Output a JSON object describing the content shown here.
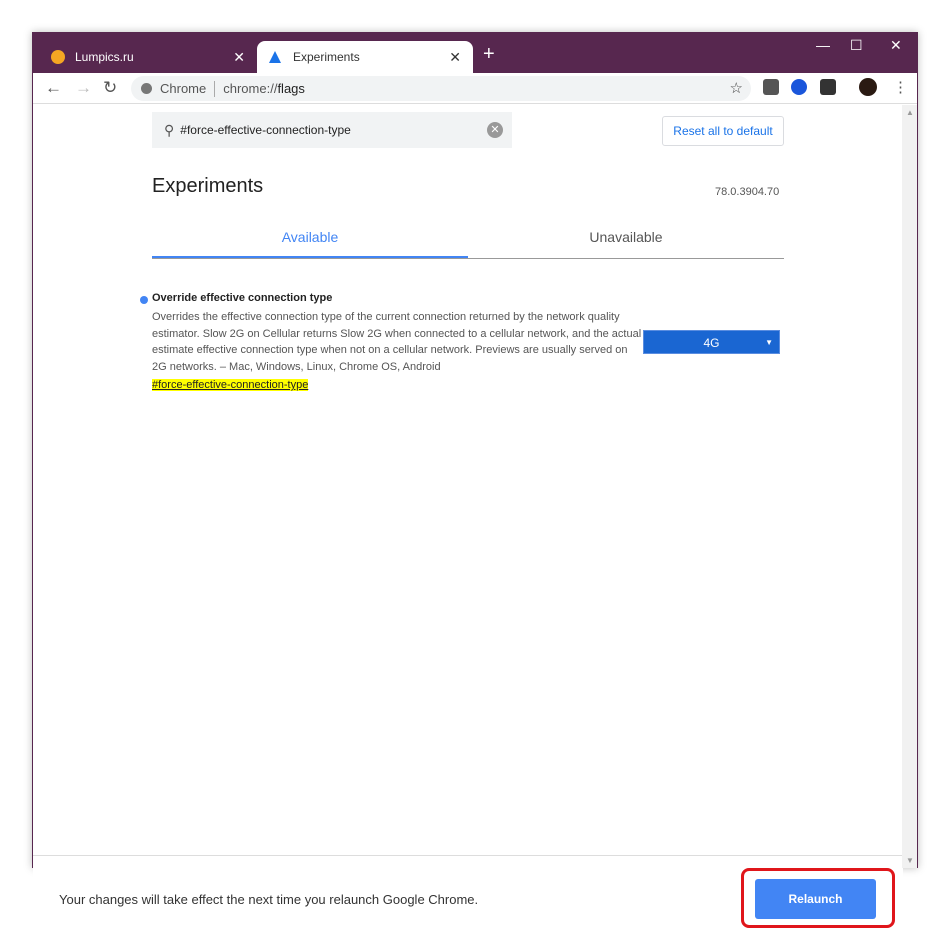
{
  "tabs": [
    {
      "title": "Lumpics.ru",
      "icon": "orange-favicon"
    },
    {
      "title": "Experiments",
      "icon": "flask-icon",
      "active": true
    }
  ],
  "address": {
    "site": "Chrome",
    "url_prefix": "chrome://",
    "url_path": "flags"
  },
  "search": {
    "value": "#force-effective-connection-type"
  },
  "reset_label": "Reset all to default",
  "page": {
    "title": "Experiments",
    "version": "78.0.3904.70",
    "tabs": [
      "Available",
      "Unavailable"
    ]
  },
  "flag": {
    "name": "Override effective connection type",
    "description": "Overrides the effective connection type of the current connection returned by the network quality estimator. Slow 2G on Cellular returns Slow 2G when connected to a cellular network, and the actual estimate effective connection type when not on a cellular network. Previews are usually served on 2G networks. – Mac, Windows, Linux, Chrome OS, Android",
    "tag": "#force-effective-connection-type",
    "value": "4G"
  },
  "footer": {
    "message": "Your changes will take effect the next time you relaunch Google Chrome.",
    "relaunch_label": "Relaunch"
  },
  "colors": {
    "titlebar": "#57274f",
    "accent": "#4285f4",
    "highlight": "#e0161b"
  }
}
